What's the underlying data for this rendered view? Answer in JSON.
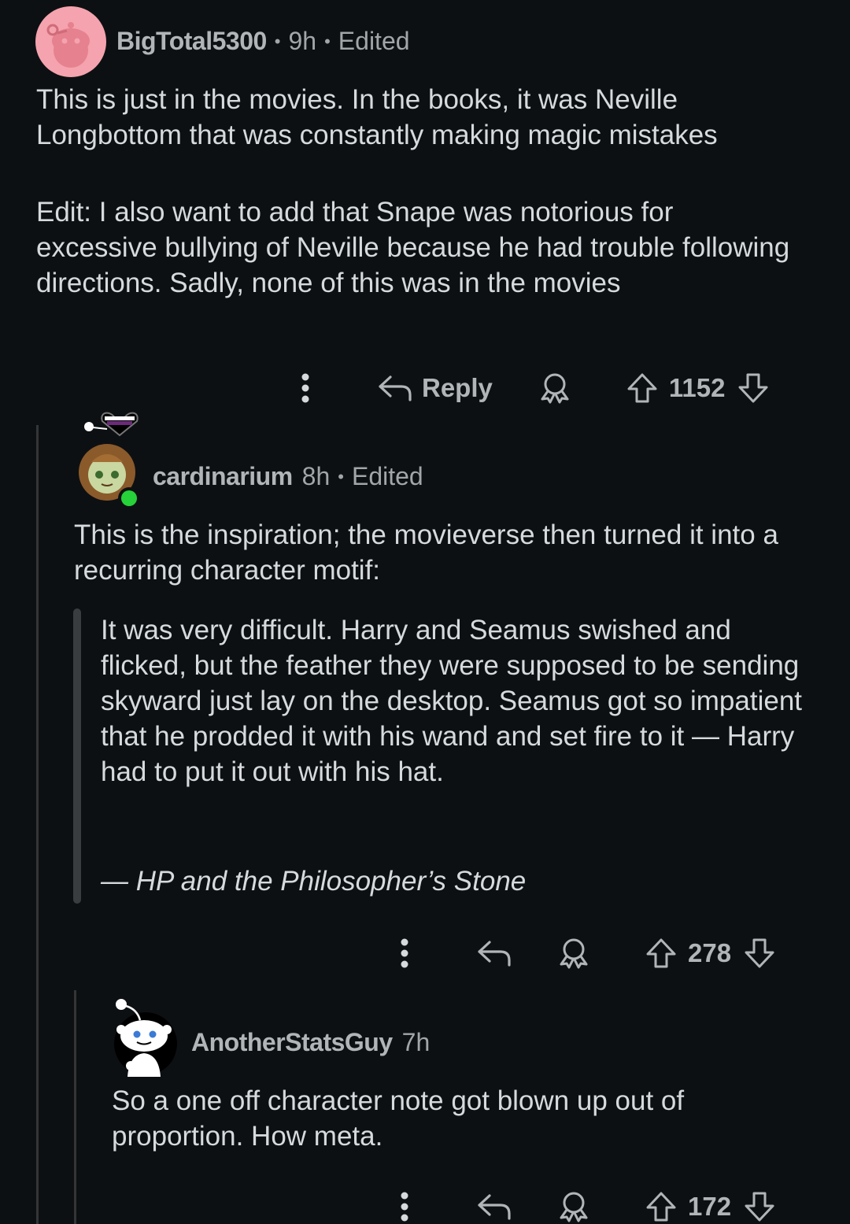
{
  "colors": {
    "background": "#0d1013",
    "text": "#d7dadc",
    "muted": "#a2a6a9",
    "avatar_pink": "#f5a3ae",
    "online_green": "#26d13a"
  },
  "comments": [
    {
      "username": "BigTotal5300",
      "age": "9h",
      "edited": "Edited",
      "body_p1": "This is just in the movies. In the books, it was Neville Longbottom that was constantly making magic mistakes",
      "body_p2": "Edit: I also want to add that Snape was notorious for excessive bullying of Neville because he had trouble following directions. Sadly, none of this was in the movies",
      "reply_label": "Reply",
      "votes": "1152",
      "icons": [
        "more-icon",
        "reply-icon",
        "award-icon",
        "upvote-icon",
        "downvote-icon"
      ]
    },
    {
      "username": "cardinarium",
      "age": "8h",
      "edited": "Edited",
      "body": "This is the inspiration; the movieverse then turned it into a recurring character motif:",
      "quote": "It was very difficult. Harry and Seamus swished and flicked, but the feather they were supposed to be sending skyward just lay on the desktop. Seamus got so impatient that he prodded it with his wand and set fire to it — Harry had to put it out with his hat.",
      "quote_cite": "— HP and the Philosopher’s Stone",
      "votes": "278"
    },
    {
      "username": "AnotherStatsGuy",
      "age": "7h",
      "body": "So a one off character note got blown up out of proportion. How meta.",
      "votes": "172"
    }
  ],
  "separator": "•"
}
